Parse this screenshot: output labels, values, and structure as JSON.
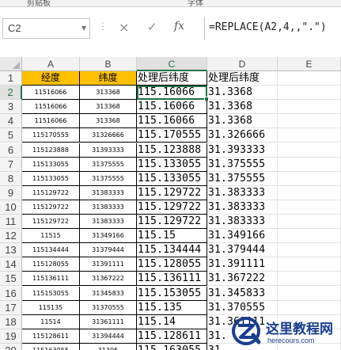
{
  "ribbon": {
    "groups": [
      "剪贴板",
      "字体"
    ]
  },
  "formula_bar": {
    "name_box": "C2",
    "cancel_glyph": "×",
    "enter_glyph": "✓",
    "fx_label": "fx",
    "formula": "=REPLACE(A2,4,,\".\")"
  },
  "sheet": {
    "columns": [
      "A",
      "B",
      "C",
      "D",
      "E"
    ],
    "selected_cell": "C2",
    "header_row": {
      "A": "经度",
      "B": "纬度",
      "C": "处理后纬度",
      "D": "处理后纬度"
    },
    "rows": [
      {
        "num": "2",
        "A": "11516066",
        "B": "313368",
        "C": "115.16066",
        "D": "31.3368"
      },
      {
        "num": "3",
        "A": "11516066",
        "B": "313368",
        "C": "115.16066",
        "D": "31.3368"
      },
      {
        "num": "4",
        "A": "11516066",
        "B": "313368",
        "C": "115.16066",
        "D": "31.3368"
      },
      {
        "num": "5",
        "A": "115170555",
        "B": "31326666",
        "C": "115.170555",
        "D": "31.326666"
      },
      {
        "num": "6",
        "A": "115123888",
        "B": "31393333",
        "C": "115.123888",
        "D": "31.393333"
      },
      {
        "num": "7",
        "A": "115133055",
        "B": "31375555",
        "C": "115.133055",
        "D": "31.375555"
      },
      {
        "num": "8",
        "A": "115133055",
        "B": "31375555",
        "C": "115.133055",
        "D": "31.375555"
      },
      {
        "num": "9",
        "A": "115129722",
        "B": "31383333",
        "C": "115.129722",
        "D": "31.383333"
      },
      {
        "num": "10",
        "A": "115129722",
        "B": "31383333",
        "C": "115.129722",
        "D": "31.383333"
      },
      {
        "num": "11",
        "A": "115129722",
        "B": "31383333",
        "C": "115.129722",
        "D": "31.383333"
      },
      {
        "num": "12",
        "A": "11515",
        "B": "31349166",
        "C": "115.15",
        "D": "31.349166"
      },
      {
        "num": "13",
        "A": "115134444",
        "B": "31379444",
        "C": "115.134444",
        "D": "31.379444"
      },
      {
        "num": "14",
        "A": "115128055",
        "B": "31391111",
        "C": "115.128055",
        "D": "31.391111"
      },
      {
        "num": "15",
        "A": "115136111",
        "B": "31367222",
        "C": "115.136111",
        "D": "31.367222"
      },
      {
        "num": "16",
        "A": "115153055",
        "B": "31345833",
        "C": "115.153055",
        "D": "31.345833"
      },
      {
        "num": "17",
        "A": "115135",
        "B": "31370555",
        "C": "115.135",
        "D": "31.370555"
      },
      {
        "num": "18",
        "A": "11514",
        "B": "31361111",
        "C": "115.14",
        "D": "31.361111"
      },
      {
        "num": "19",
        "A": "115128611",
        "B": "31394444",
        "C": "115.128611",
        "D": "31."
      },
      {
        "num": "20",
        "A": "115163055",
        "B": "31305",
        "C": "115.163055",
        "D": "31."
      }
    ]
  },
  "watermark": {
    "title": "这里教程网",
    "url": "herecours.com",
    "color": "#1a3d8f"
  },
  "colors": {
    "header_fill": "#ffc000",
    "accent": "#217346"
  }
}
